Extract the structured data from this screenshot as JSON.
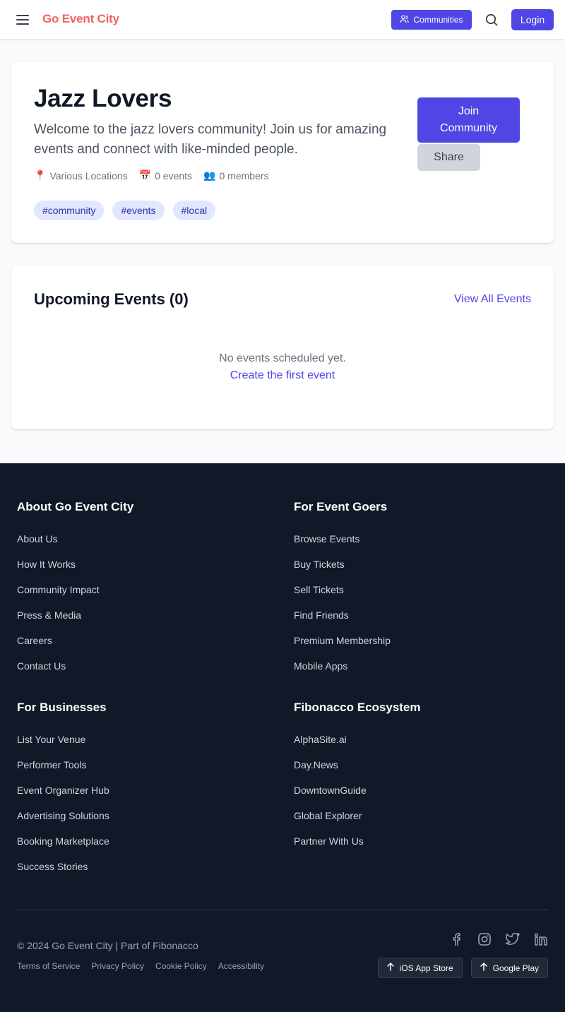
{
  "header": {
    "brand": "Go Event City",
    "communities_label": "Communities",
    "login_label": "Login"
  },
  "community": {
    "title": "Jazz Lovers",
    "description": "Welcome to the jazz lovers community! Join us for amazing events and connect with like-minded people.",
    "location": "Various Locations",
    "events_count": "0 events",
    "members_count": "0 members",
    "tags": [
      "#community",
      "#events",
      "#local"
    ],
    "join_label": "Join Community",
    "share_label": "Share"
  },
  "events": {
    "title": "Upcoming Events (0)",
    "view_all_label": "View All Events",
    "empty_text": "No events scheduled yet.",
    "create_label": "Create the first event"
  },
  "footer": {
    "columns": [
      {
        "heading": "About Go Event City",
        "links": [
          "About Us",
          "How It Works",
          "Community Impact",
          "Press & Media",
          "Careers",
          "Contact Us"
        ]
      },
      {
        "heading": "For Event Goers",
        "links": [
          "Browse Events",
          "Buy Tickets",
          "Sell Tickets",
          "Find Friends",
          "Premium Membership",
          "Mobile Apps"
        ]
      },
      {
        "heading": "For Businesses",
        "links": [
          "List Your Venue",
          "Performer Tools",
          "Event Organizer Hub",
          "Advertising Solutions",
          "Booking Marketplace",
          "Success Stories"
        ]
      },
      {
        "heading": "Fibonacco Ecosystem",
        "links": [
          "AlphaSite.ai",
          "Day.News",
          "DowntownGuide",
          "Global Explorer",
          "Partner With Us"
        ]
      }
    ],
    "copyright": "© 2024 Go Event City | Part of Fibonacco",
    "legal_links": [
      "Terms of Service",
      "Privacy Policy",
      "Cookie Policy",
      "Accessibility"
    ],
    "socials": [
      "facebook-icon",
      "instagram-icon",
      "twitter-icon",
      "linkedin-icon"
    ],
    "store_buttons": [
      "iOS App Store",
      "Google Play"
    ]
  },
  "colors": {
    "brand": "#ef6363",
    "accent": "#4f46e5",
    "footer_bg": "#111827"
  }
}
